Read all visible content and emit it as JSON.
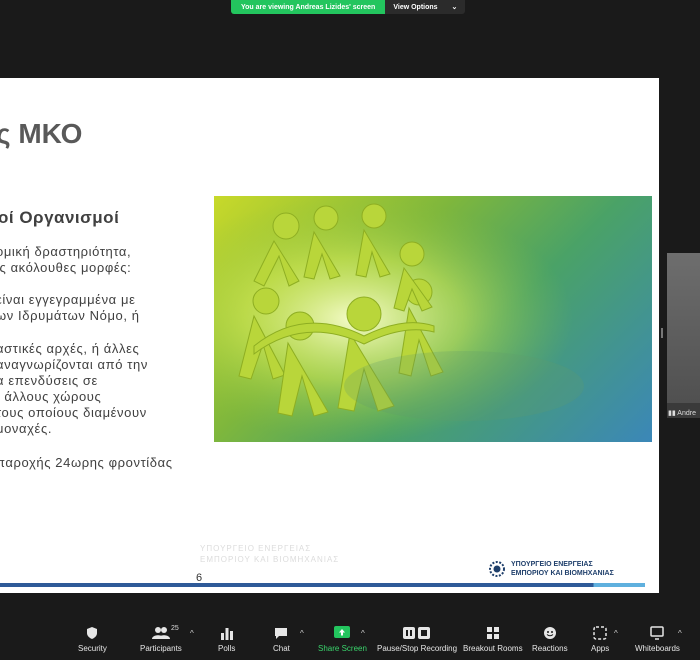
{
  "share_banner": {
    "text": "You are viewing Andreas Lizides' screen",
    "view_options": "View Options",
    "caret": "⌄"
  },
  "slide": {
    "title": "ς ΜΚΟ",
    "subtitle": "οί Οργανισμοί",
    "para1": [
      "ομική δραστηριότητα,",
      "ις ακόλουθες μορφές:"
    ],
    "para2": [
      " είναι εγγεγραμμένα με",
      "ων Ιδρυμάτων Νόμο, ή"
    ],
    "para3": [
      "αστικές αρχές, ή άλλες",
      "αναγνωρίζονται από την",
      "α επενδύσεις σε",
      ", άλλους χώρους",
      "τους οποίους διαμένουν",
      "μοναχές."
    ],
    "para4": [
      "παροχής 24ωρης φροντίδας"
    ],
    "watermark": [
      "ΥΠΟΥΡΓΕΙΟ ΕΝΕΡΓΕΙΑΣ",
      "ΕΜΠΟΡΙΟΥ ΚΑΙ ΒΙΟΜΗΧΑΝΙΑΣ"
    ],
    "page_number": "6",
    "logo_line1": "ΥΠΟΥΡΓΕΙΟ ΕΝΕΡΓΕΙΑΣ",
    "logo_line2": "ΕΜΠΟΡΙΟΥ ΚΑΙ ΒΙΟΜΗΧΑΝΙΑΣ"
  },
  "video_tile": {
    "name": "Andre"
  },
  "toolbar": {
    "security": "Security",
    "participants": "Participants",
    "participants_count": "25",
    "polls": "Polls",
    "chat": "Chat",
    "share_screen": "Share Screen",
    "pause_recording": "Pause/Stop Recording",
    "breakout_rooms": "Breakout Rooms",
    "reactions": "Reactions",
    "apps": "Apps",
    "whiteboards": "Whiteboards",
    "caret": "^"
  },
  "colors": {
    "accent_green": "#23c55e",
    "share_green": "#3ad46c",
    "footer_blue": "#2e5a98"
  }
}
